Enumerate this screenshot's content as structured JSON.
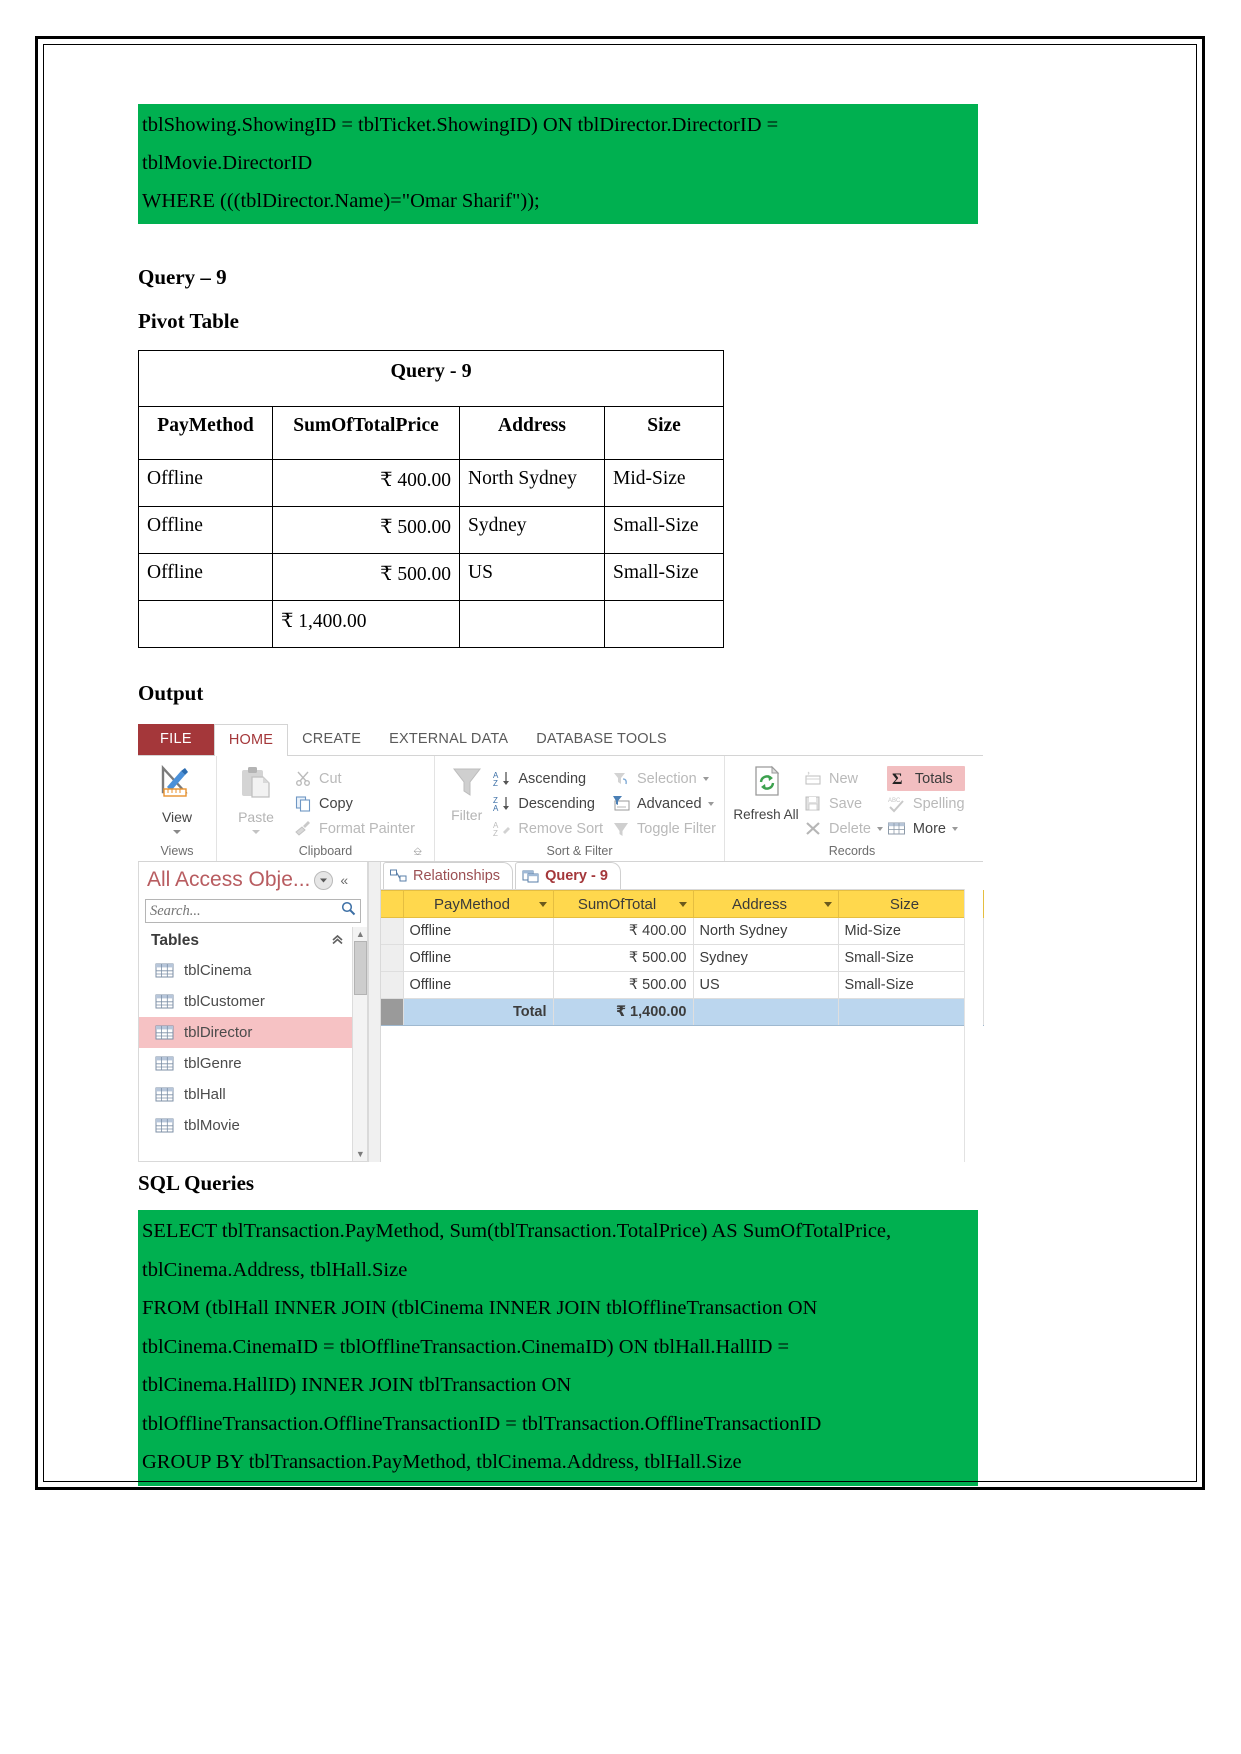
{
  "document": {
    "top_sql_lines": [
      "tblShowing.ShowingID = tblTicket.ShowingID) ON tblDirector.DirectorID =",
      "tblMovie.DirectorID",
      "WHERE (((tblDirector.Name)=\"Omar Sharif\"));"
    ],
    "query_heading": "Query – 9",
    "pivot_heading": "Pivot Table",
    "output_heading": "Output",
    "sql_heading": "SQL Queries",
    "bottom_sql_lines": [
      "SELECT tblTransaction.PayMethod, Sum(tblTransaction.TotalPrice) AS SumOfTotalPrice,",
      "tblCinema.Address, tblHall.Size",
      "FROM (tblHall INNER JOIN (tblCinema INNER JOIN tblOfflineTransaction ON",
      "tblCinema.CinemaID = tblOfflineTransaction.CinemaID) ON tblHall.HallID =",
      "tblCinema.HallID) INNER JOIN tblTransaction ON",
      "tblOfflineTransaction.OfflineTransactionID = tblTransaction.OfflineTransactionID",
      "GROUP BY tblTransaction.PayMethod, tblCinema.Address, tblHall.Size"
    ]
  },
  "pivot_table": {
    "title": "Query - 9",
    "headers": [
      "PayMethod",
      "SumOfTotalPrice",
      "Address",
      "Size"
    ],
    "rows": [
      [
        "Offline",
        "₹ 400.00",
        "North Sydney",
        "Mid-Size"
      ],
      [
        "Offline",
        "₹ 500.00",
        "Sydney",
        "Small-Size"
      ],
      [
        "Offline",
        "₹ 500.00",
        "US",
        "Small-Size"
      ]
    ],
    "total_row": [
      "",
      "₹ 1,400.00",
      "",
      ""
    ]
  },
  "access": {
    "ribbon_tabs": [
      {
        "label": "FILE",
        "kind": "file"
      },
      {
        "label": "HOME",
        "kind": "selected"
      },
      {
        "label": "CREATE",
        "kind": "normal"
      },
      {
        "label": "EXTERNAL DATA",
        "kind": "normal"
      },
      {
        "label": "DATABASE TOOLS",
        "kind": "normal"
      }
    ],
    "groups": {
      "views": {
        "label": "Views",
        "button": "View"
      },
      "clipboard": {
        "label": "Clipboard",
        "paste": "Paste",
        "items": [
          "Cut",
          "Copy",
          "Format Painter"
        ]
      },
      "sort_filter": {
        "label": "Sort & Filter",
        "filter": "Filter",
        "col1": [
          "Ascending",
          "Descending",
          "Remove Sort"
        ],
        "col2": [
          "Selection",
          "Advanced",
          "Toggle Filter"
        ]
      },
      "records": {
        "label": "Records",
        "refresh": "Refresh All",
        "col1": [
          "New",
          "Save",
          "Delete"
        ],
        "col2": [
          "Totals",
          "Spelling",
          "More"
        ]
      }
    },
    "nav_pane": {
      "title": "All Access Obje...",
      "search_placeholder": "Search...",
      "search_value": "",
      "group_label": "Tables",
      "items": [
        {
          "label": "tblCinema",
          "selected": false
        },
        {
          "label": "tblCustomer",
          "selected": false
        },
        {
          "label": "tblDirector",
          "selected": true
        },
        {
          "label": "tblGenre",
          "selected": false
        },
        {
          "label": "tblHall",
          "selected": false
        },
        {
          "label": "tblMovie",
          "selected": false
        }
      ]
    },
    "doc_tabs": [
      {
        "label": "Relationships",
        "active": false
      },
      {
        "label": "Query - 9",
        "active": true
      }
    ],
    "datasheet": {
      "headers": [
        "PayMethod",
        "SumOfTotal",
        "Address",
        "Size"
      ],
      "rows": [
        [
          "Offline",
          "₹ 400.00",
          "North Sydney",
          "Mid-Size"
        ],
        [
          "Offline",
          "₹ 500.00",
          "Sydney",
          "Small-Size"
        ],
        [
          "Offline",
          "₹ 500.00",
          "US",
          "Small-Size"
        ]
      ],
      "total_label": "Total",
      "total_value": "₹ 1,400.00"
    }
  },
  "colors": {
    "sql_green": "#00B050",
    "access_red": "#A4373A",
    "header_yellow": "#FFD84D",
    "selection_pink": "#F6C2C4",
    "total_blue": "#BBD6EE"
  }
}
